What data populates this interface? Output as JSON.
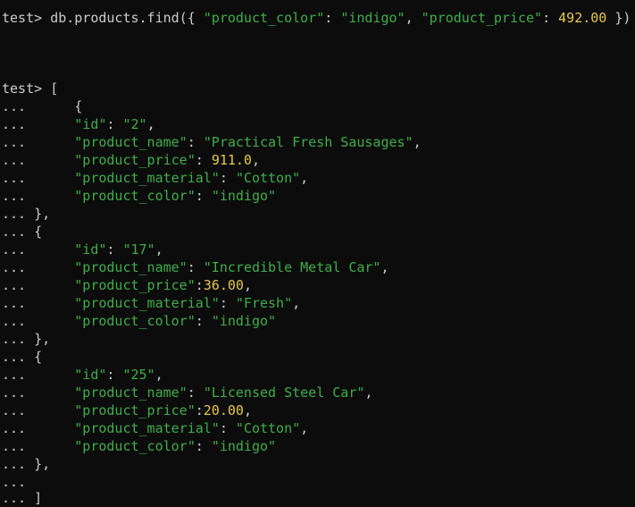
{
  "colors": {
    "background": "#0c0c0c",
    "default_text": "#cccccc",
    "string": "#3fae48",
    "number": "#e8c84a"
  },
  "command": {
    "prompt": "test> ",
    "call": "db.products.find({ ",
    "key1": "\"product_color\"",
    "sep1": ": ",
    "val1": "\"indigo\"",
    "comma1": ", ",
    "key2": "\"product_price\"",
    "sep2": ": ",
    "val2": "492.00",
    "close": " })"
  },
  "input": {
    "prompt": "test> ",
    "open_bracket": "[",
    "continuation": "...",
    "close_bracket": "]",
    "records": [
      {
        "open": "{",
        "close": "},",
        "id_key": "\"id\"",
        "id_val": "\"2\"",
        "name_key": "\"product_name\"",
        "name_val": "\"Practical Fresh Sausages\"",
        "price_key": "\"product_price\"",
        "price_sep": ": ",
        "price_val": "911.0",
        "material_key": "\"product_material\"",
        "material_val": "\"Cotton\"",
        "color_key": "\"product_color\"",
        "color_val": "\"indigo\""
      },
      {
        "open": "{",
        "close": "},",
        "id_key": "\"id\"",
        "id_val": "\"17\"",
        "name_key": "\"product_name\"",
        "name_val": "\"Incredible Metal Car\"",
        "price_key": "\"product_price\"",
        "price_sep": ":",
        "price_val": "36.00",
        "material_key": "\"product_material\"",
        "material_val": "\"Fresh\"",
        "color_key": "\"product_color\"",
        "color_val": "\"indigo\""
      },
      {
        "open": "{",
        "close": "},",
        "id_key": "\"id\"",
        "id_val": "\"25\"",
        "name_key": "\"product_name\"",
        "name_val": "\"Licensed Steel Car\"",
        "price_key": "\"product_price\"",
        "price_sep": ":",
        "price_val": "20.00",
        "material_key": "\"product_material\"",
        "material_val": "\"Cotton\"",
        "color_key": "\"product_color\"",
        "color_val": "\"indigo\""
      }
    ]
  }
}
